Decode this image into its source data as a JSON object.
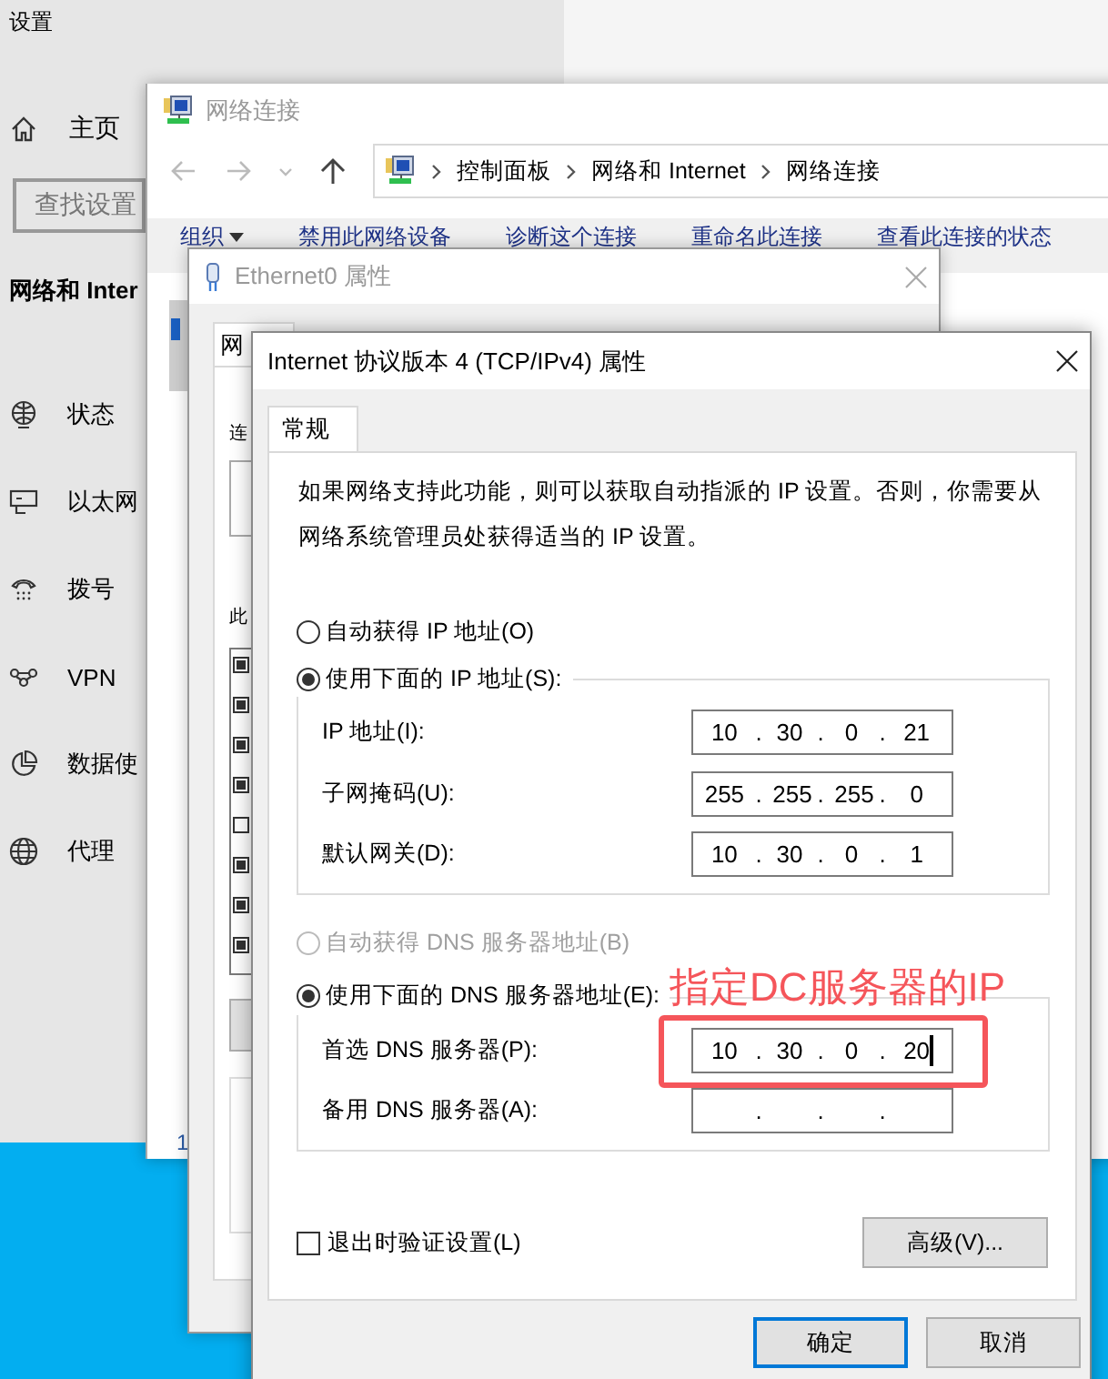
{
  "settings": {
    "title": "设置",
    "home": "主页",
    "search": {
      "placeholder": "查找设置"
    },
    "section": "网络和 Inter",
    "nav": [
      {
        "label": "状态"
      },
      {
        "label": "以太网"
      },
      {
        "label": "拨号"
      },
      {
        "label": "VPN"
      },
      {
        "label": "数据使"
      },
      {
        "label": "代理"
      }
    ]
  },
  "network_connections": {
    "title": "网络连接",
    "breadcrumb": [
      "控制面板",
      "网络和 Internet",
      "网络连接"
    ],
    "toolbar": [
      "组织",
      "禁用此网络设备",
      "诊断这个连接",
      "重命名此连接",
      "查看此连接的状态"
    ],
    "status_bar": "1"
  },
  "ethernet_properties": {
    "title": "Ethernet0 属性",
    "tab": "网",
    "labels": [
      "连",
      "此"
    ],
    "components": [
      {
        "checked": true
      },
      {
        "checked": true
      },
      {
        "checked": true
      },
      {
        "checked": true
      },
      {
        "checked": false
      },
      {
        "checked": true
      },
      {
        "checked": true
      },
      {
        "checked": true
      }
    ]
  },
  "ipv4_properties": {
    "title": "Internet 协议版本 4 (TCP/IPv4) 属性",
    "tabs": [
      {
        "label": "常规",
        "selected": true
      }
    ],
    "description": "如果网络支持此功能，则可以获取自动指派的 IP 设置。否则，你需要从网络系统管理员处获得适当的 IP 设置。",
    "ip_mode": [
      {
        "label": "自动获得 IP 地址(O)",
        "selected": false
      },
      {
        "label": "使用下面的 IP 地址(S):",
        "selected": true
      }
    ],
    "ip_fields": [
      {
        "label": "IP 地址(I):",
        "value": "10 . 30 . 0 . 21",
        "focused": false,
        "highlighted": false
      },
      {
        "label": "子网掩码(U):",
        "value": "255 . 255 . 255 . 0",
        "focused": false,
        "highlighted": false
      },
      {
        "label": "默认网关(D):",
        "value": "10 . 30 . 0 . 1",
        "focused": false,
        "highlighted": false
      }
    ],
    "dns_mode": [
      {
        "label": "自动获得 DNS 服务器地址(B)",
        "selected": false,
        "disabled": true
      },
      {
        "label": "使用下面的 DNS 服务器地址(E):",
        "selected": true,
        "disabled": false
      }
    ],
    "dns_fields": [
      {
        "label": "首选 DNS 服务器(P):",
        "value": "10 . 30 . 0 . 20",
        "focused": true,
        "highlighted": true
      },
      {
        "label": "备用 DNS 服务器(A):",
        "value": ". . .",
        "focused": false,
        "highlighted": false
      }
    ],
    "annotation": "指定DC服务器的IP",
    "validate": {
      "label": "退出时验证设置(L)",
      "checked": false
    },
    "advanced_button": "高级(V)...",
    "buttons": [
      {
        "label": "确定",
        "default": true
      },
      {
        "label": "取消",
        "default": false
      }
    ]
  }
}
